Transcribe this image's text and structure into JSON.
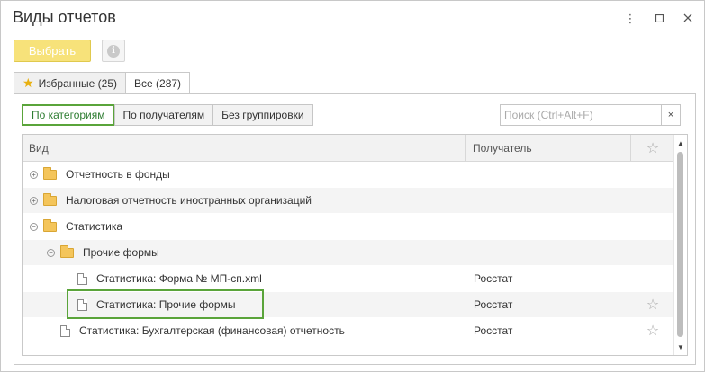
{
  "window": {
    "title": "Виды отчетов",
    "icons": [
      "more-vertical-icon",
      "maximize-icon",
      "close-icon"
    ]
  },
  "toolbar": {
    "select_label": "Выбрать",
    "info_icon": "i"
  },
  "tabs": [
    {
      "label": "Избранные (25)",
      "icon": "star-icon",
      "active": false
    },
    {
      "label": "Все (287)",
      "active": true
    }
  ],
  "grouping": {
    "buttons": [
      {
        "label": "По категориям",
        "active": true
      },
      {
        "label": "По получателям",
        "active": false
      },
      {
        "label": "Без группировки",
        "active": false
      }
    ]
  },
  "search": {
    "placeholder": "Поиск (Ctrl+Alt+F)",
    "clear_label": "×"
  },
  "grid": {
    "columns": {
      "vid": "Вид",
      "recipient": "Получатель",
      "favorite_icon": "☆"
    },
    "rows": [
      {
        "type": "folder",
        "indent": 0,
        "expander": "+",
        "label": "Отчетность в фонды",
        "recipient": "",
        "star": ""
      },
      {
        "type": "folder",
        "indent": 0,
        "expander": "+",
        "label": "Налоговая отчетность иностранных организаций",
        "recipient": "",
        "star": ""
      },
      {
        "type": "folder",
        "indent": 0,
        "expander": "−",
        "label": "Статистика",
        "recipient": "",
        "star": ""
      },
      {
        "type": "folder",
        "indent": 1,
        "expander": "−",
        "label": "Прочие формы",
        "recipient": "",
        "star": ""
      },
      {
        "type": "doc",
        "indent": 2,
        "label": "Статистика: Форма № МП-сп.xml",
        "recipient": "Росстат",
        "star": ""
      },
      {
        "type": "doc",
        "indent": 2,
        "label": "Статистика: Прочие формы",
        "recipient": "Росстат",
        "star": "☆",
        "highlighted": true
      },
      {
        "type": "doc",
        "indent": 1,
        "label": "Статистика: Бухгалтерская (финансовая) отчетность",
        "recipient": "Росстат",
        "star": "☆"
      }
    ]
  },
  "colors": {
    "accent_green": "#5aa43a",
    "select_button": "#f7e27a",
    "folder": "#f4c55b"
  }
}
